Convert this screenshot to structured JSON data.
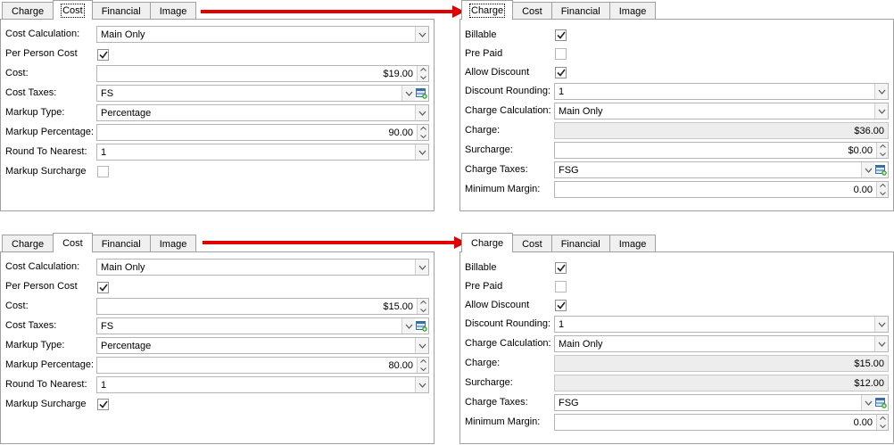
{
  "tabs": [
    "Charge",
    "Cost",
    "Financial",
    "Image"
  ],
  "top": {
    "cost": {
      "cost_calculation": "Main Only",
      "per_person_cost": true,
      "cost": "$19.00",
      "cost_taxes": "FS",
      "markup_type": "Percentage",
      "markup_percentage": "90.00",
      "round_to_nearest": "1",
      "markup_surcharge": false
    },
    "charge": {
      "billable": true,
      "pre_paid": false,
      "allow_discount": true,
      "discount_rounding": "1",
      "charge_calculation": "Main Only",
      "charge": "$36.00",
      "surcharge": "$0.00",
      "charge_taxes": "FSG",
      "minimum_margin": "0.00"
    }
  },
  "bottom": {
    "cost": {
      "cost_calculation": "Main Only",
      "per_person_cost": true,
      "cost": "$15.00",
      "cost_taxes": "FS",
      "markup_type": "Percentage",
      "markup_percentage": "80.00",
      "round_to_nearest": "1",
      "markup_surcharge": true
    },
    "charge": {
      "billable": true,
      "pre_paid": false,
      "allow_discount": true,
      "discount_rounding": "1",
      "charge_calculation": "Main Only",
      "charge": "$15.00",
      "surcharge": "$12.00",
      "charge_taxes": "FSG",
      "minimum_margin": "0.00"
    }
  },
  "labels": {
    "cost_calculation": "Cost Calculation:",
    "per_person_cost": "Per Person Cost",
    "cost": "Cost:",
    "cost_taxes": "Cost Taxes:",
    "markup_type": "Markup Type:",
    "markup_percentage": "Markup Percentage:",
    "round_to_nearest": "Round To Nearest:",
    "markup_surcharge": "Markup Surcharge",
    "billable": "Billable",
    "pre_paid": "Pre Paid",
    "allow_discount": "Allow Discount",
    "discount_rounding": "Discount Rounding:",
    "charge_calculation": "Charge Calculation:",
    "charge": "Charge:",
    "surcharge": "Surcharge:",
    "charge_taxes": "Charge Taxes:",
    "minimum_margin": "Minimum Margin:"
  },
  "colors": {
    "arrow": "#e00000",
    "border": "#a0a0a0",
    "readonly_bg": "#ededed"
  }
}
